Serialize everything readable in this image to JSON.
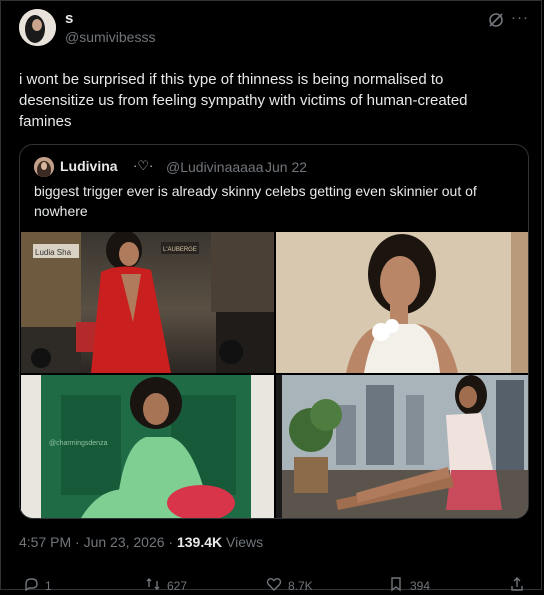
{
  "author": {
    "name": "s",
    "handle": "@sumivibesss"
  },
  "tweet_text": "i wont be surprised if this type of thinness is being normalised to desensitize us from feeling sympathy with victims of human-created famines",
  "quote": {
    "name": "Ludivina",
    "badge": "·♡·",
    "handle": "@Ludivinaaaaa",
    "separator": "·",
    "date": "Jun 22",
    "text": "biggest trigger ever is already skinny celebs getting even skinnier out of nowhere",
    "photo1_sign": "Ludia Sha",
    "photo1_sign2": "L'AUBERGE",
    "photo3_watermark": "@charmingsdenza"
  },
  "meta": {
    "time": "4:57 PM · Jun 23, 2026 · ",
    "views_count": "139.4K",
    "views_label": " Views"
  },
  "actions": {
    "replies": "1",
    "reposts": "627",
    "likes": "8.7K",
    "bookmarks": "394"
  },
  "icons": {
    "more": "more-icon",
    "grok": "grok-icon",
    "reply": "reply-icon",
    "repost": "repost-icon",
    "like": "heart-icon",
    "bookmark": "bookmark-icon",
    "share": "share-icon"
  }
}
